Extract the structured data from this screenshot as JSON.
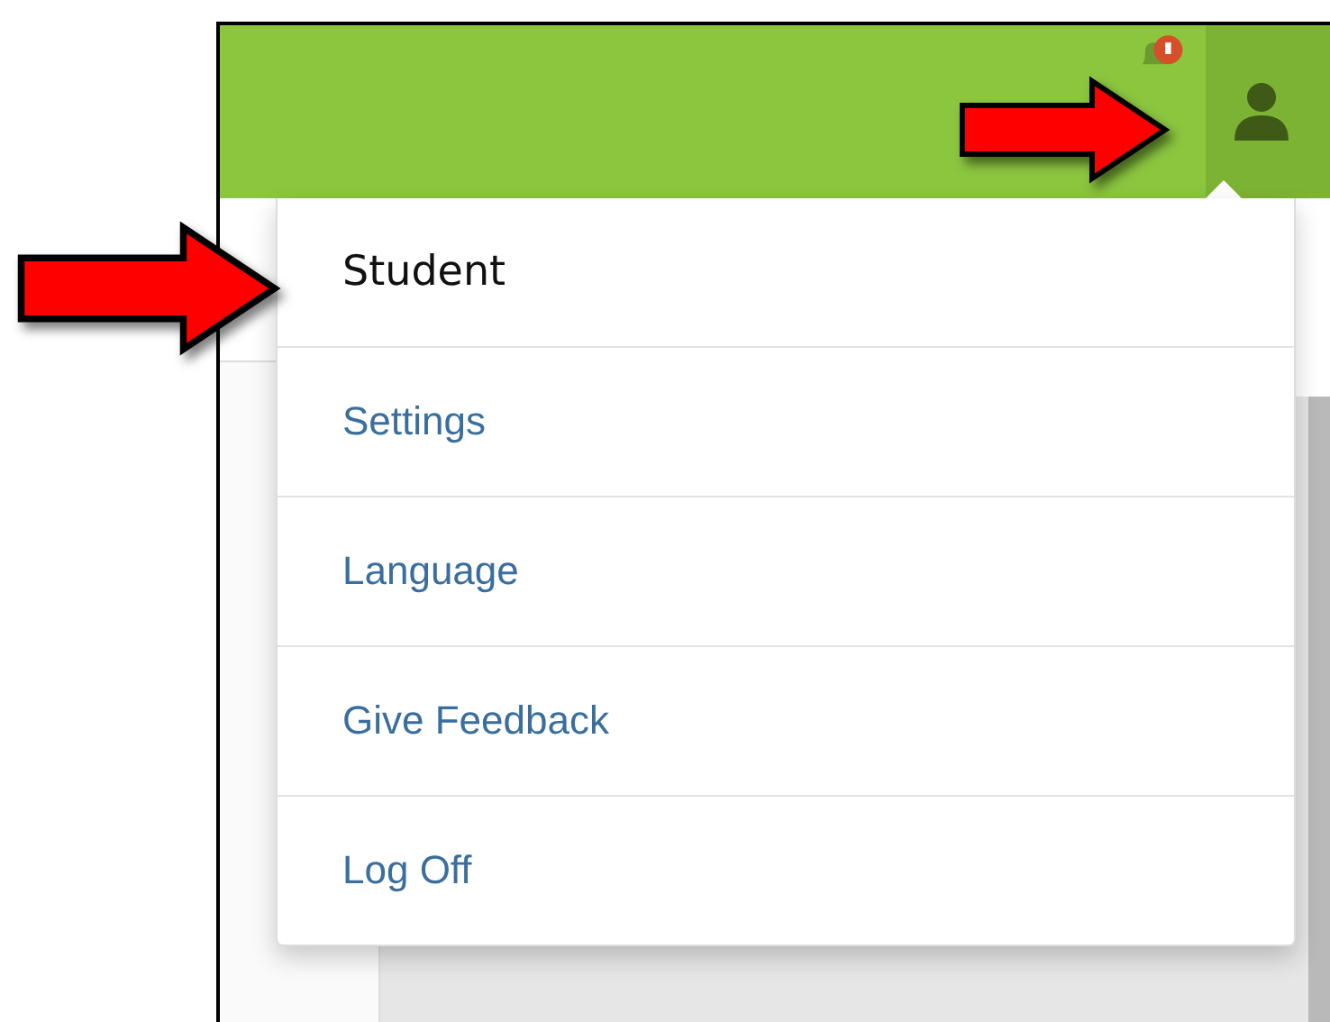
{
  "header": {
    "notification_badge": true,
    "user_menu_open": true
  },
  "user_menu": {
    "title": "Student",
    "items": [
      {
        "label": "Settings"
      },
      {
        "label": "Language"
      },
      {
        "label": "Give Feedback"
      },
      {
        "label": "Log Off"
      }
    ]
  }
}
